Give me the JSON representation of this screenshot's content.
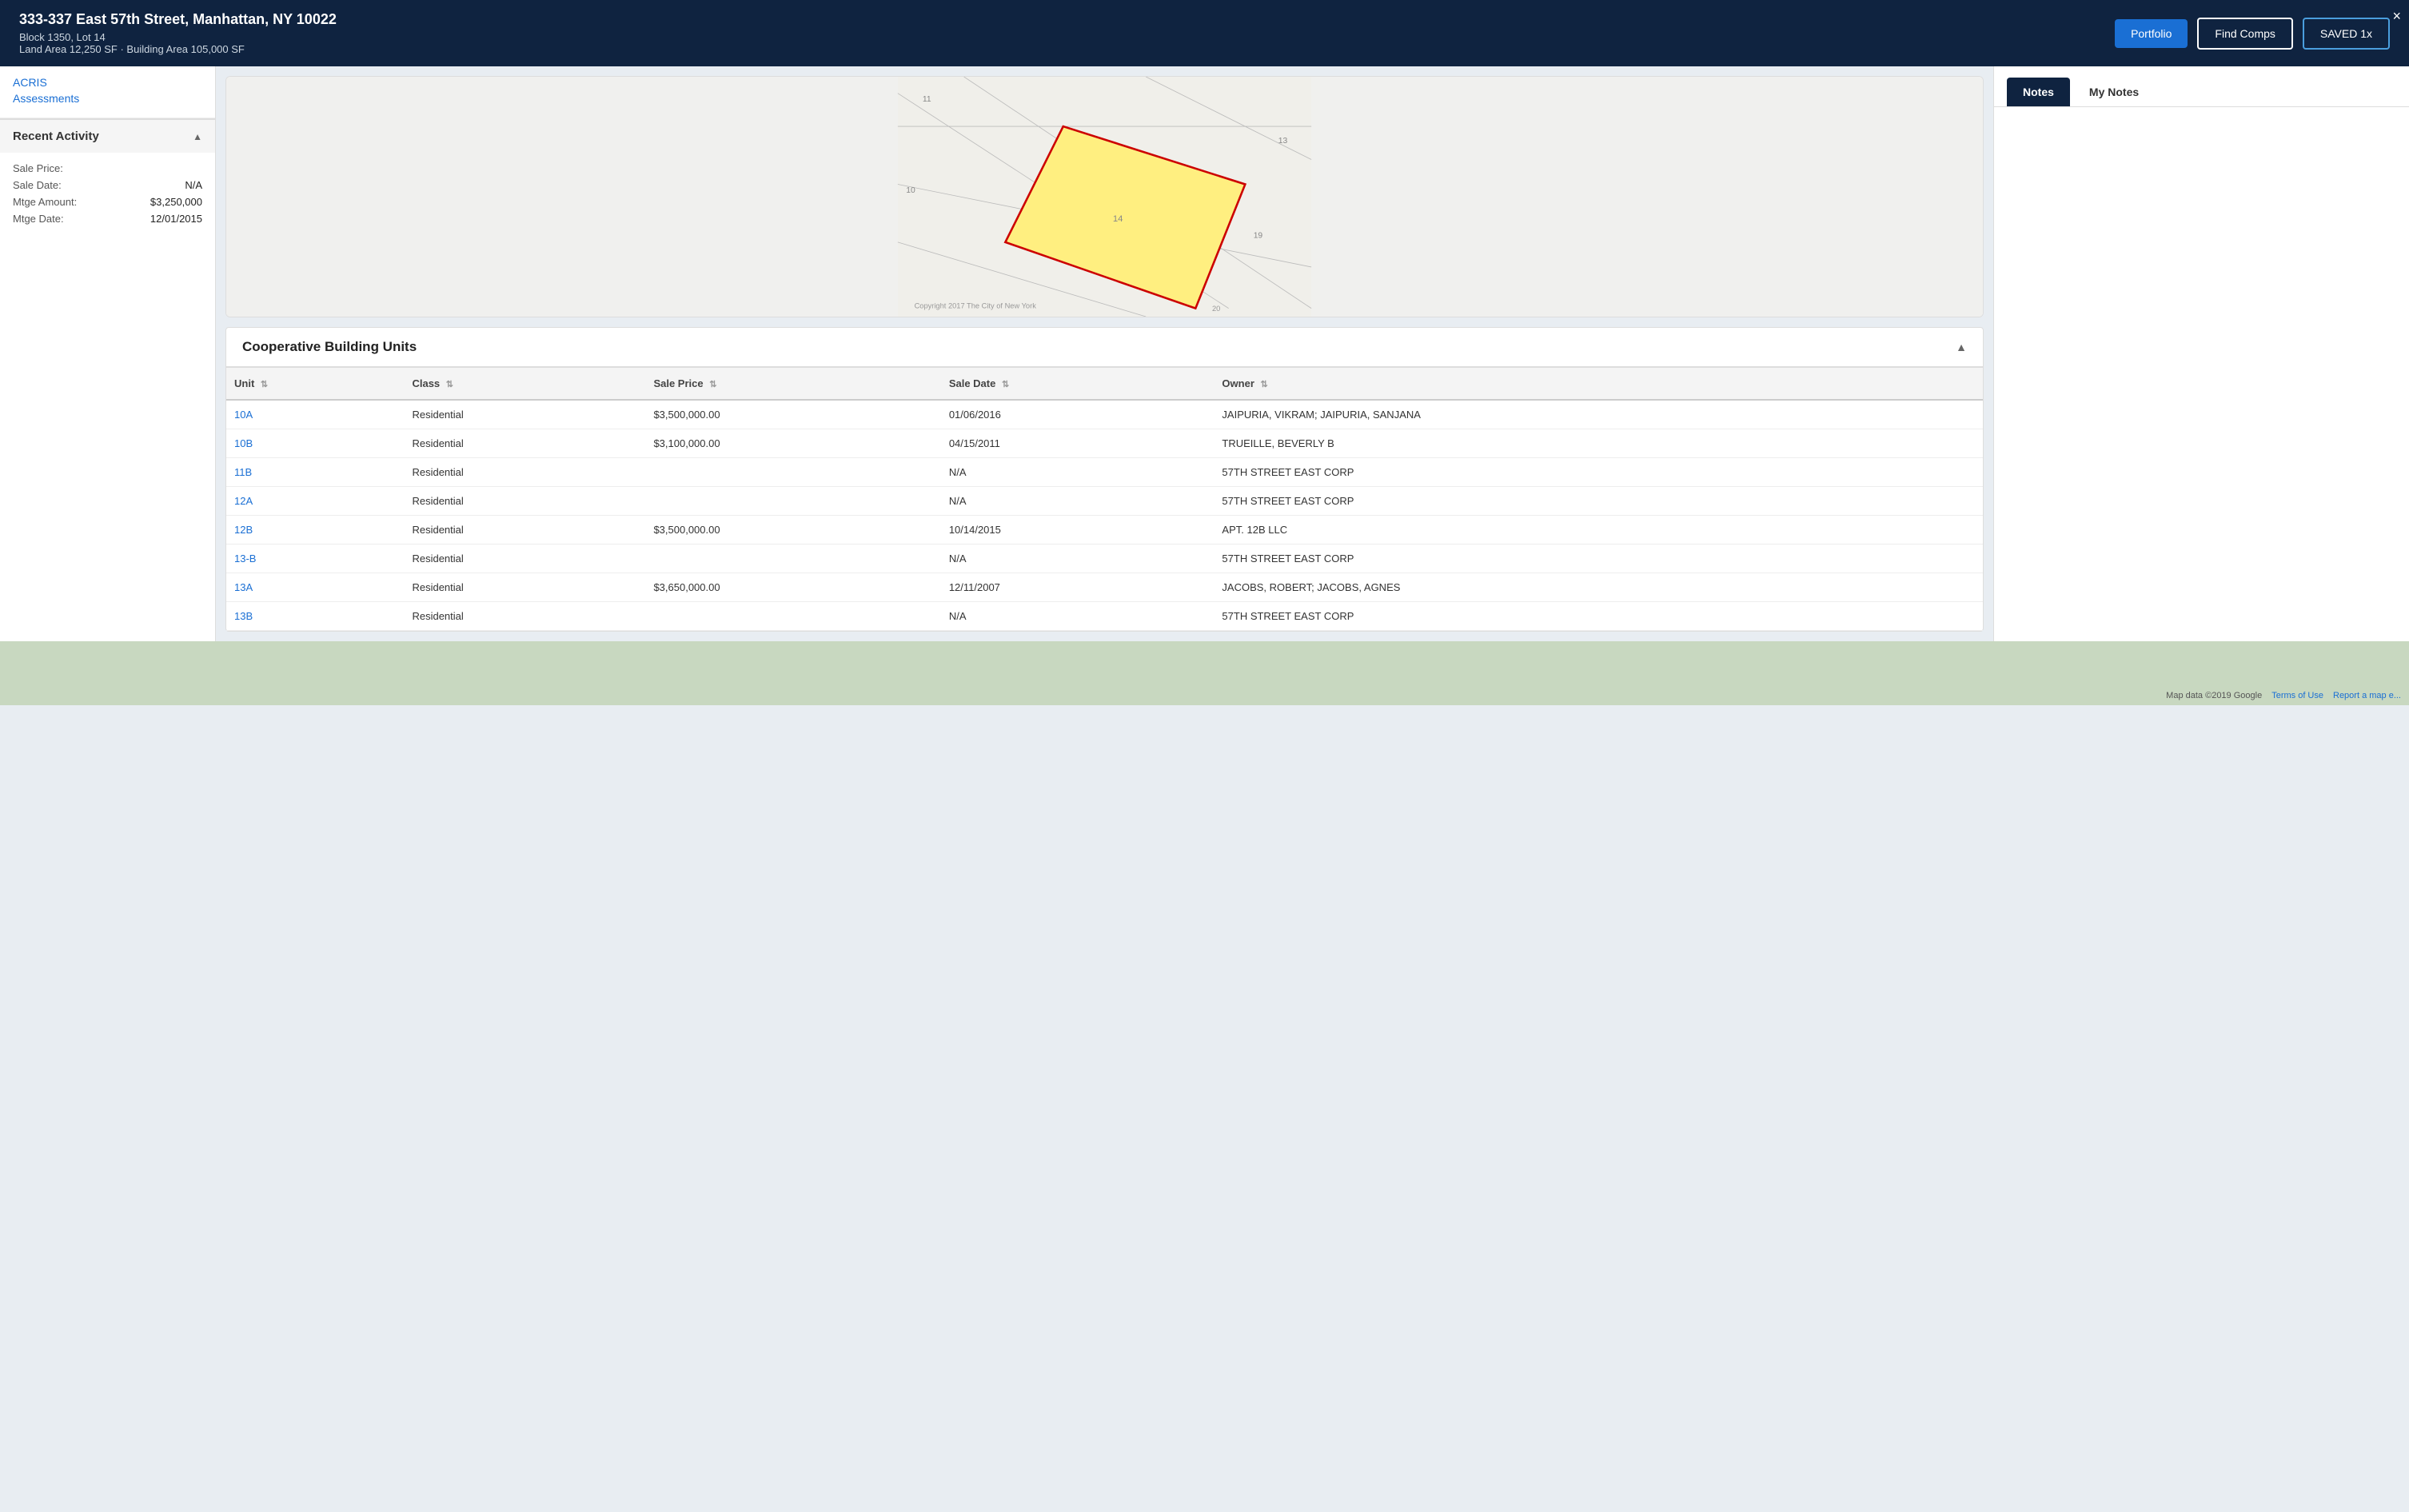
{
  "header": {
    "title": "333-337 East 57th Street, Manhattan, NY 10022",
    "subtitle1": "Block 1350, Lot 14",
    "subtitle2": "Land Area 12,250 SF · Building Area 105,000 SF",
    "close_label": "×",
    "btn_portfolio": "Portfolio",
    "btn_find_comps": "Find Comps",
    "btn_saved": "SAVED 1x"
  },
  "sidebar": {
    "links": [
      {
        "label": "ACRIS"
      },
      {
        "label": "Assessments"
      }
    ],
    "recent_activity": {
      "section_title": "Recent Activity",
      "items": [
        {
          "label": "Sale Price:",
          "value": ""
        },
        {
          "label": "Sale Date:",
          "value": "N/A"
        },
        {
          "label": "Mtge Amount:",
          "value": "$3,250,000"
        },
        {
          "label": "Mtge Date:",
          "value": "12/01/2015"
        }
      ]
    }
  },
  "notes": {
    "tab_notes": "Notes",
    "tab_my_notes": "My Notes"
  },
  "coop": {
    "title": "Cooperative Building Units",
    "columns": [
      {
        "label": "Unit"
      },
      {
        "label": "Class"
      },
      {
        "label": "Sale Price"
      },
      {
        "label": "Sale Date"
      },
      {
        "label": "Owner"
      }
    ],
    "rows": [
      {
        "unit": "10A",
        "class": "Residential",
        "sale_price": "$3,500,000.00",
        "sale_date": "01/06/2016",
        "owner": "JAIPURIA, VIKRAM; JAIPURIA, SANJANA"
      },
      {
        "unit": "10B",
        "class": "Residential",
        "sale_price": "$3,100,000.00",
        "sale_date": "04/15/2011",
        "owner": "TRUEILLE, BEVERLY B"
      },
      {
        "unit": "11B",
        "class": "Residential",
        "sale_price": "",
        "sale_date": "N/A",
        "owner": "57TH STREET EAST CORP"
      },
      {
        "unit": "12A",
        "class": "Residential",
        "sale_price": "",
        "sale_date": "N/A",
        "owner": "57TH STREET EAST CORP"
      },
      {
        "unit": "12B",
        "class": "Residential",
        "sale_price": "$3,500,000.00",
        "sale_date": "10/14/2015",
        "owner": "APT. 12B LLC"
      },
      {
        "unit": "13-B",
        "class": "Residential",
        "sale_price": "",
        "sale_date": "N/A",
        "owner": "57TH STREET EAST CORP"
      },
      {
        "unit": "13A",
        "class": "Residential",
        "sale_price": "$3,650,000.00",
        "sale_date": "12/11/2007",
        "owner": "JACOBS, ROBERT; JACOBS, AGNES"
      },
      {
        "unit": "13B",
        "class": "Residential",
        "sale_price": "",
        "sale_date": "N/A",
        "owner": "57TH STREET EAST CORP"
      }
    ]
  },
  "bottom_bar": {
    "map_data": "Map data ©2019 Google",
    "terms": "Terms of Use",
    "report": "Report a map e..."
  }
}
